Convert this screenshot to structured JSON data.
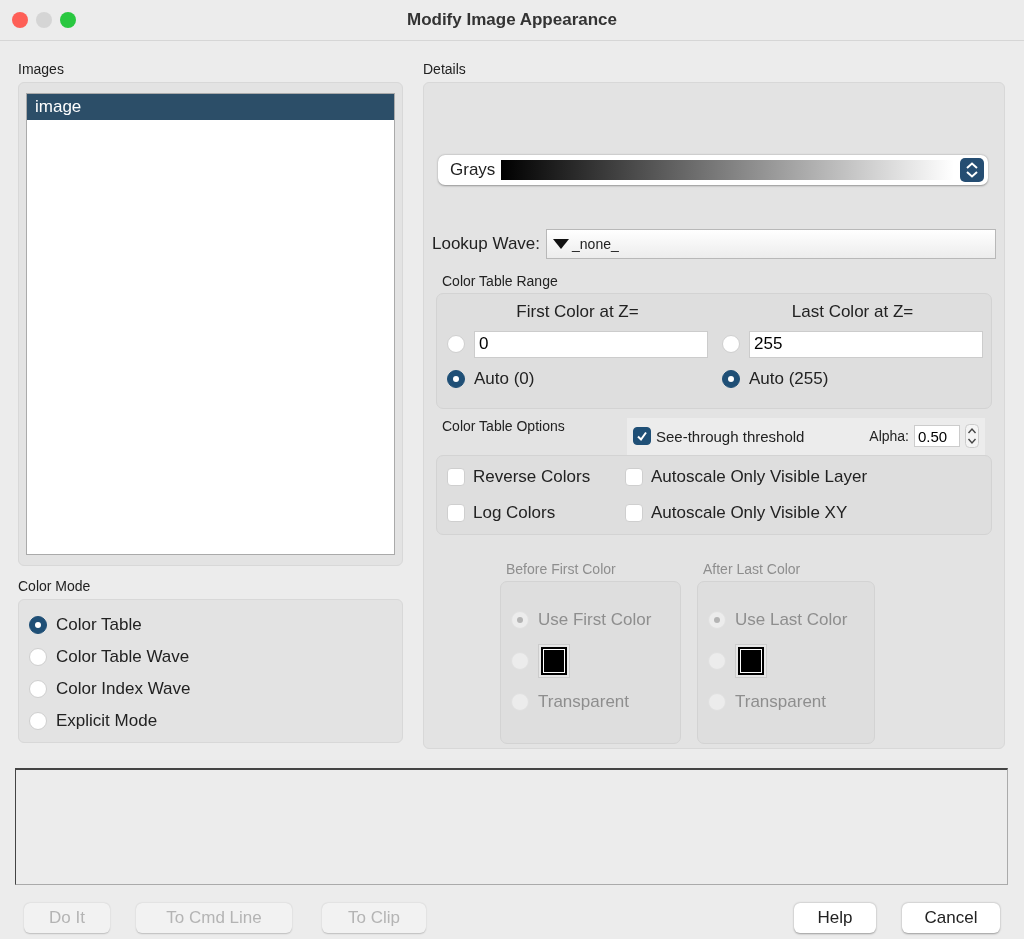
{
  "window": {
    "title": "Modify Image Appearance"
  },
  "images": {
    "label": "Images",
    "items": [
      {
        "name": "image",
        "selected": true
      }
    ]
  },
  "color_mode": {
    "label": "Color Mode",
    "options": [
      {
        "label": "Color Table",
        "selected": true
      },
      {
        "label": "Color Table Wave",
        "selected": false
      },
      {
        "label": "Color Index Wave",
        "selected": false
      },
      {
        "label": "Explicit Mode",
        "selected": false
      }
    ]
  },
  "details": {
    "label": "Details",
    "color_table": {
      "value": "Grays"
    },
    "lookup_wave": {
      "label": "Lookup Wave:",
      "value": "_none_"
    },
    "range": {
      "label": "Color Table Range",
      "columns": [
        {
          "heading": "First Color at Z=",
          "choices": [
            {
              "kind": "value",
              "value": "0",
              "selected": false
            },
            {
              "kind": "auto",
              "label": "Auto (0)",
              "selected": true
            }
          ]
        },
        {
          "heading": "Last Color at Z=",
          "choices": [
            {
              "kind": "value",
              "value": "255",
              "selected": false
            },
            {
              "kind": "auto",
              "label": "Auto (255)",
              "selected": true
            }
          ]
        }
      ]
    },
    "options": {
      "label": "Color Table Options",
      "see_through": {
        "label": "See-through threshold",
        "checked": true
      },
      "alpha": {
        "label": "Alpha:",
        "value": "0.50"
      },
      "checkboxes": [
        {
          "label": "Reverse Colors",
          "checked": false
        },
        {
          "label": "Autoscale Only Visible Layer",
          "checked": false
        },
        {
          "label": "Log Colors",
          "checked": false
        },
        {
          "label": "Autoscale Only Visible XY",
          "checked": false
        }
      ]
    },
    "out_of_range": [
      {
        "label": "Before First Color",
        "disabled": true,
        "choices": [
          {
            "kind": "text",
            "label": "Use First Color",
            "selected": true
          },
          {
            "kind": "swatch",
            "color": "#000000",
            "selected": false
          },
          {
            "kind": "text",
            "label": "Transparent",
            "selected": false
          }
        ]
      },
      {
        "label": "After Last Color",
        "disabled": true,
        "choices": [
          {
            "kind": "text",
            "label": "Use Last Color",
            "selected": true
          },
          {
            "kind": "swatch",
            "color": "#000000",
            "selected": false
          },
          {
            "kind": "text",
            "label": "Transparent",
            "selected": false
          }
        ]
      }
    ]
  },
  "buttons": [
    {
      "label": "Do It",
      "disabled": true
    },
    {
      "label": "To Cmd Line",
      "disabled": true
    },
    {
      "label": "To Clip",
      "disabled": true
    },
    {
      "label": "Help",
      "disabled": false
    },
    {
      "label": "Cancel",
      "disabled": false
    }
  ]
}
